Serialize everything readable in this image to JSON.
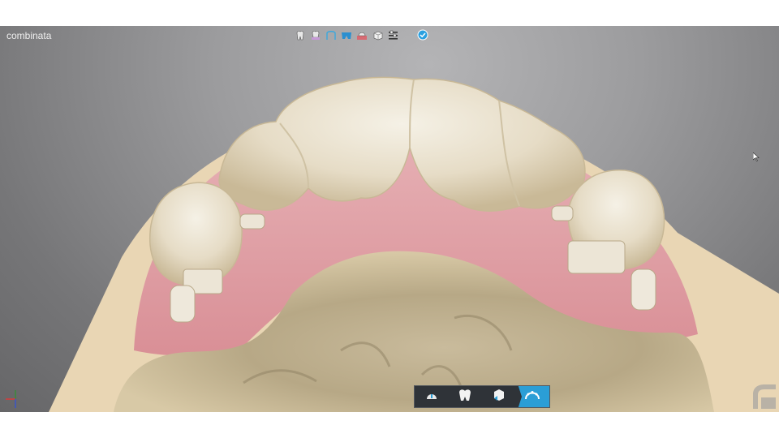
{
  "window": {
    "title": "combinata"
  },
  "toolbar": {
    "icons": [
      "single-tooth-icon",
      "gingiva-tooth-icon",
      "arch-curve-icon",
      "bridge-teeth-icon",
      "red-tooth-icon",
      "cube-icon",
      "sliders-icon"
    ],
    "confirm_icon": "check-circle-icon"
  },
  "workflow_bar": {
    "steps": [
      {
        "icon": "gauge-icon",
        "active": false
      },
      {
        "icon": "tooth-crown-icon",
        "active": false
      },
      {
        "icon": "model-box-icon",
        "active": false
      },
      {
        "icon": "jaw-arch-icon",
        "active": true
      }
    ]
  },
  "colors": {
    "viewport_background": "#8e8e90",
    "tooth": "#e9e2d2",
    "gingiva": "#e3a6ab",
    "base": "#e9d6b4",
    "accent": "#2b9ed6",
    "workflow_bar": "#2f3338"
  }
}
